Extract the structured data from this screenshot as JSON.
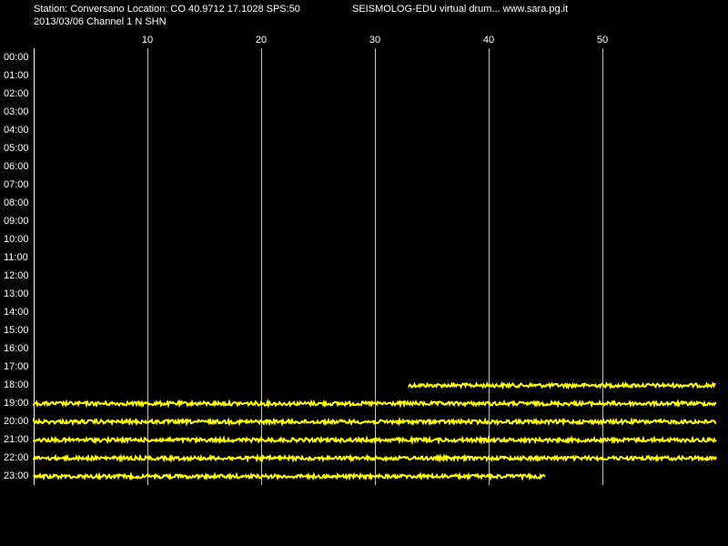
{
  "header": {
    "station_line": "Station: Conversano Location: CO 40.9712 17.1028 SPS:50",
    "brand_line": "SEISMOLOG-EDU virtual drum... www.sara.pg.it",
    "date_line": "2013/03/06  Channel 1 N SHN"
  },
  "colors": {
    "background": "#000000",
    "text": "#ffffff",
    "grid": "#ffffff",
    "trace": "#ffff00"
  },
  "chart_data": {
    "type": "line",
    "title": "",
    "xlabel": "",
    "ylabel": "",
    "x_unit": "minutes",
    "xlim": [
      0,
      60
    ],
    "x_ticks": [
      10,
      20,
      30,
      40,
      50
    ],
    "x_tick_labels": [
      "10",
      "20",
      "30",
      "40",
      "50"
    ],
    "grid": "vertical lines at x ticks",
    "rows": [
      "00:00",
      "01:00",
      "02:00",
      "03:00",
      "04:00",
      "05:00",
      "06:00",
      "07:00",
      "08:00",
      "09:00",
      "10:00",
      "11:00",
      "12:00",
      "13:00",
      "14:00",
      "15:00",
      "16:00",
      "17:00",
      "18:00",
      "19:00",
      "20:00",
      "21:00",
      "22:00",
      "23:00"
    ],
    "traces": [
      {
        "row": "18:00",
        "start_min": 33,
        "end_min": 60
      },
      {
        "row": "19:00",
        "start_min": 0,
        "end_min": 60
      },
      {
        "row": "20:00",
        "start_min": 0,
        "end_min": 60
      },
      {
        "row": "21:00",
        "start_min": 0,
        "end_min": 60
      },
      {
        "row": "22:00",
        "start_min": 0,
        "end_min": 60
      },
      {
        "row": "23:00",
        "start_min": 0,
        "end_min": 45
      }
    ]
  }
}
